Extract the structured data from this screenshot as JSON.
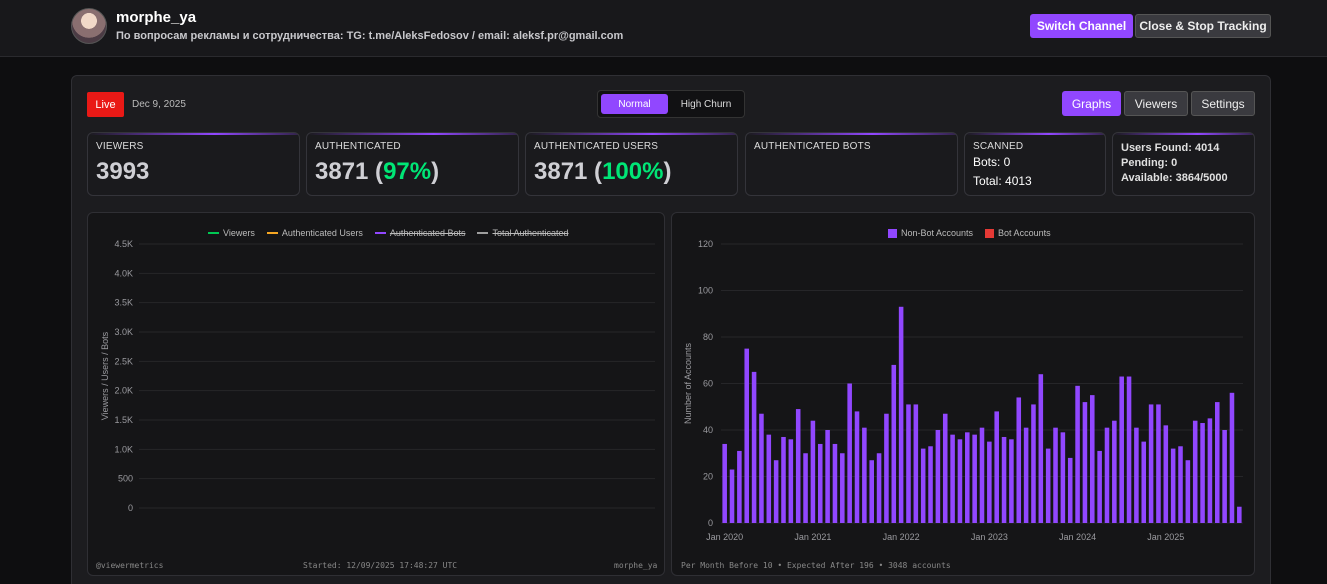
{
  "header": {
    "channel_name": "morphe_ya",
    "description": "По вопросам рекламы и сотрудничества: TG: t.me/AleksFedosov / email: aleksf.pr@gmail.com",
    "switch_label": "Switch Channel",
    "close_label": "Close & Stop Tracking"
  },
  "status": {
    "live_label": "Live",
    "date": "Dec 9, 2025"
  },
  "mode": {
    "normal_label": "Normal",
    "high_churn_label": "High Churn",
    "active": "Normal"
  },
  "view_tabs": {
    "graphs": "Graphs",
    "viewers": "Viewers",
    "settings": "Settings",
    "active": "Graphs"
  },
  "stats": {
    "viewers": {
      "title": "VIEWERS",
      "value": "3993"
    },
    "authenticated": {
      "title": "AUTHENTICATED",
      "value": "3871",
      "pct_open": " (",
      "pct": "97%",
      "pct_close": ")"
    },
    "authenticated_users": {
      "title": "AUTHENTICATED USERS",
      "value": "3871",
      "pct_open": " (",
      "pct": "100%",
      "pct_close": ")"
    },
    "authenticated_bots": {
      "title": "AUTHENTICATED BOTS"
    },
    "scanned": {
      "title": "SCANNED",
      "bots": "Bots: 0",
      "total": "Total: 4013"
    },
    "found": {
      "users_found": "Users Found: 4014",
      "pending": "Pending: 0",
      "available": "Available: 3864/5000"
    }
  },
  "colors": {
    "accent": "#9147ff",
    "live": "#e91916",
    "pct_green": "#00e676",
    "viewers_line": "#00c853",
    "auth_users_line": "#f5a623",
    "bots_line": "#9147ff",
    "total_line": "#9e9e9e",
    "bot_accounts": "#e53935"
  },
  "line_chart_footer": {
    "left": "@viewermetrics",
    "center": "Started: 12/09/2025 17:48:27 UTC",
    "right": "morphe_ya"
  },
  "bar_chart_footer": "Per Month Before 10 • Expected After 196 • 3048 accounts",
  "chart_data": [
    {
      "type": "line",
      "ylabel": "Viewers / Users / Bots",
      "ylim": [
        0,
        4500
      ],
      "y_ticks": [
        "0",
        "500",
        "1.0K",
        "1.5K",
        "2.0K",
        "2.5K",
        "3.0K",
        "3.5K",
        "4.0K",
        "4.5K"
      ],
      "grid": true,
      "legend_position": "top-center",
      "series": [
        {
          "name": "Viewers",
          "values": [],
          "hidden": false
        },
        {
          "name": "Authenticated Users",
          "values": [],
          "hidden": false
        },
        {
          "name": "Authenticated Bots",
          "values": [],
          "hidden": true
        },
        {
          "name": "Total Authenticated",
          "values": [],
          "hidden": true
        }
      ]
    },
    {
      "type": "bar",
      "ylabel": "Number of Accounts",
      "ylim": [
        0,
        120
      ],
      "y_ticks": [
        "0",
        "20",
        "40",
        "60",
        "80",
        "100",
        "120"
      ],
      "x_tick_labels": [
        "Jan 2020",
        "Jan 2021",
        "Jan 2022",
        "Jan 2023",
        "Jan 2024",
        "Jan 2025"
      ],
      "grid": true,
      "legend_position": "top-center",
      "series": [
        {
          "name": "Non-Bot Accounts",
          "values": [
            34,
            23,
            31,
            75,
            65,
            47,
            38,
            27,
            37,
            36,
            49,
            30,
            44,
            34,
            40,
            34,
            30,
            60,
            48,
            41,
            27,
            30,
            47,
            68,
            93,
            51,
            51,
            32,
            33,
            40,
            47,
            38,
            36,
            39,
            38,
            41,
            35,
            48,
            37,
            36,
            54,
            41,
            51,
            64,
            32,
            41,
            39,
            28,
            59,
            52,
            55,
            31,
            41,
            44,
            63,
            63,
            41,
            35,
            51,
            51,
            42,
            32,
            33,
            27,
            44,
            43,
            45,
            52,
            40,
            56,
            7
          ]
        },
        {
          "name": "Bot Accounts",
          "values": []
        }
      ]
    }
  ]
}
